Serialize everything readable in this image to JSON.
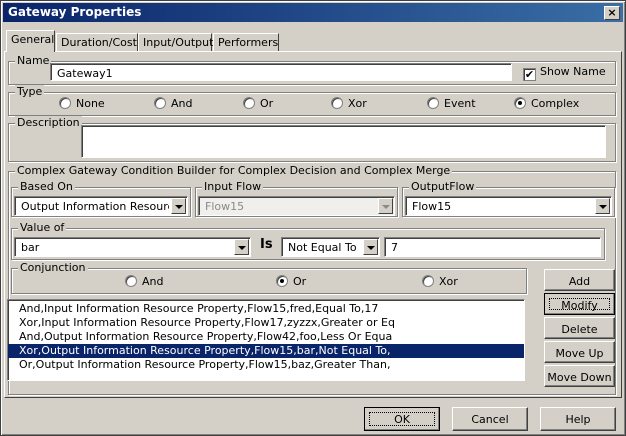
{
  "window": {
    "title": "Gateway Properties",
    "close": "×"
  },
  "tabs": [
    {
      "label": "General",
      "active": true
    },
    {
      "label": "Duration/Cost"
    },
    {
      "label": "Input/Output"
    },
    {
      "label": "Performers"
    }
  ],
  "name_group": {
    "legend": "Name",
    "value": "Gateway1",
    "show_name_label": "Show Name",
    "show_name_checked": "✔"
  },
  "type_group": {
    "legend": "Type",
    "options": [
      "None",
      "And",
      "Or",
      "Xor",
      "Event",
      "Complex"
    ],
    "selected": "Complex"
  },
  "description_group": {
    "legend": "Description",
    "value": ""
  },
  "builder": {
    "legend": "Complex Gateway Condition Builder for Complex Decision and Complex Merge",
    "based_on": {
      "legend": "Based On",
      "value": "Output Information Resource Pro"
    },
    "input_flow": {
      "legend": "Input Flow",
      "value": "Flow15"
    },
    "output_flow": {
      "legend": "OutputFlow",
      "value": "Flow15"
    },
    "value_of": {
      "legend": "Value of",
      "value": "bar",
      "is_label": "Is",
      "operator": "Not Equal To",
      "compare": "7"
    },
    "conjunction": {
      "legend": "Conjunction",
      "options": [
        "And",
        "Or",
        "Xor"
      ],
      "selected": "Or"
    },
    "conditions": [
      "And,Input Information Resource Property,Flow15,fred,Equal To,17",
      "Xor,Input Information Resource Property,Flow17,zyzzx,Greater or Eq",
      "And,Output Information Resource Property,Flow42,foo,Less Or Equa",
      "Xor,Output Information Resource Property,Flow15,bar,Not Equal To,",
      "Or,Output Information Resource Property,Flow15,baz,Greater Than,"
    ],
    "selected_index": 3,
    "side_buttons": {
      "add": "Add",
      "modify": "Modify",
      "delete": "Delete",
      "move_up": "Move Up",
      "move_down": "Move Down"
    }
  },
  "footer": {
    "ok": "OK",
    "cancel": "Cancel",
    "help": "Help"
  },
  "colors": {
    "selection": "#0a246a",
    "title_start": "#0a246a",
    "title_end": "#3a6ea5",
    "face": "#d4d0c8"
  }
}
